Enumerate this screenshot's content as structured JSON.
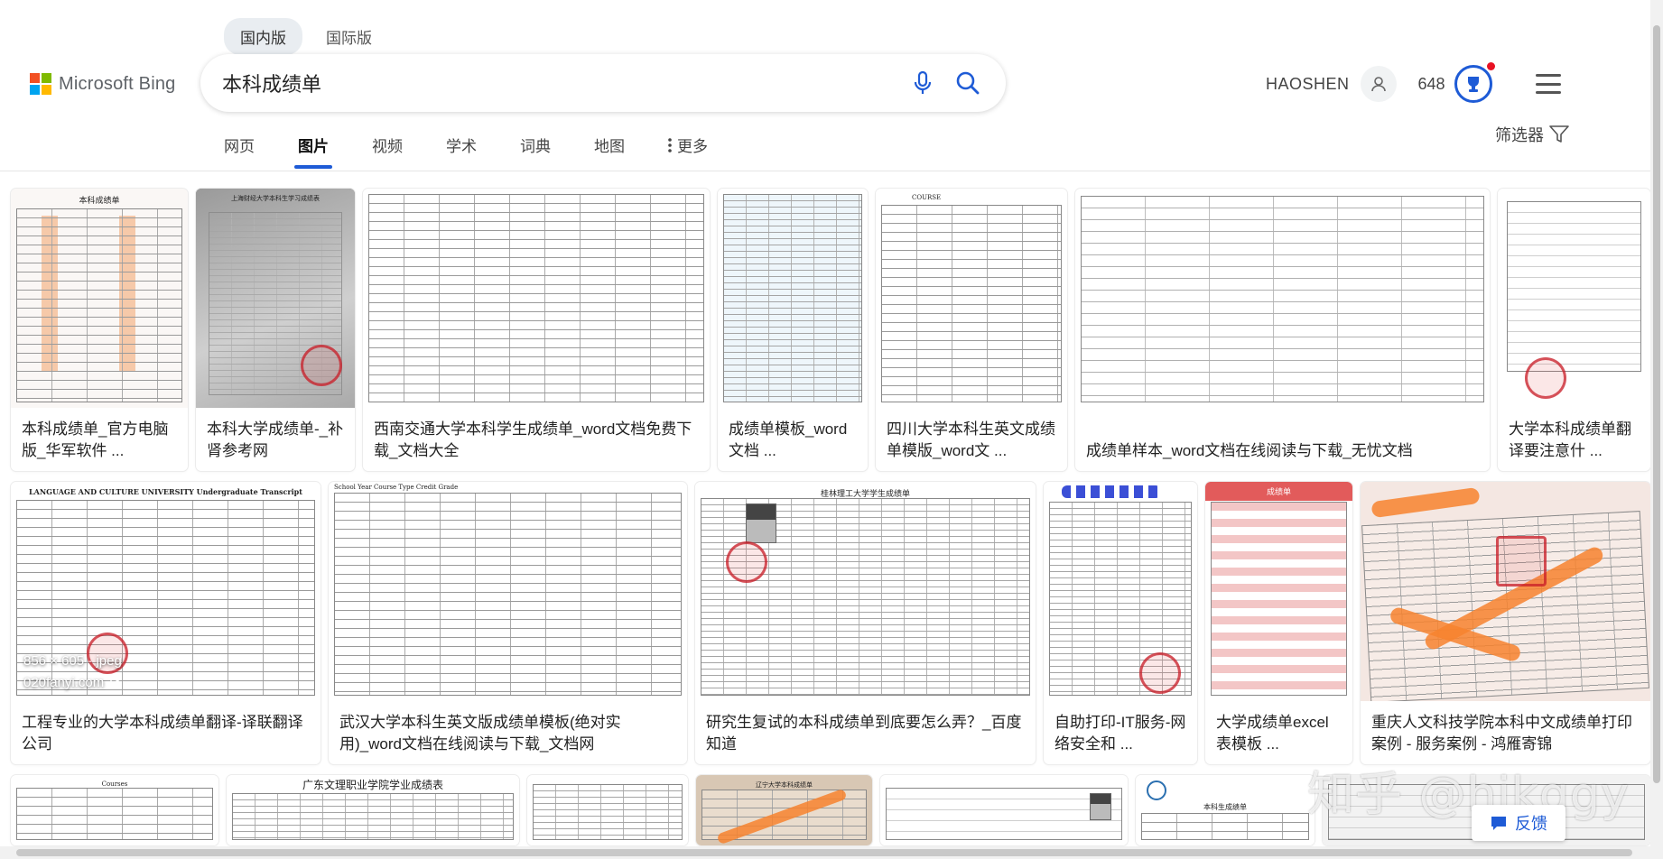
{
  "region_tabs": [
    {
      "label": "国内版",
      "active": true
    },
    {
      "label": "国际版",
      "active": false
    }
  ],
  "brand": {
    "name": "Microsoft Bing",
    "colors": [
      "#f25022",
      "#7fba00",
      "#00a4ef",
      "#ffb900"
    ]
  },
  "search": {
    "query": "本科成绩单",
    "mic_icon": "mic-icon",
    "search_icon": "search-icon"
  },
  "user": {
    "name": "HAOSHEN",
    "points": "648"
  },
  "nav": {
    "items": [
      "网页",
      "图片",
      "视频",
      "学术",
      "词典",
      "地图"
    ],
    "active_index": 1,
    "more_label": "更多",
    "filter_label": "筛选器"
  },
  "accent_color": "#1e5bd6",
  "results": {
    "row1": [
      {
        "caption": "本科成绩单_官方电脑版_华军软件 ...",
        "thumb_title": "本科成绩单"
      },
      {
        "caption": "本科大学成绩单-_补肾参考网",
        "thumb_title": "上海财经大学本科生学习成绩表"
      },
      {
        "caption": "西南交通大学本科学生成绩单_word文档免费下载_文档大全",
        "thumb_title": ""
      },
      {
        "caption": "成绩单模板_word文档 ...",
        "thumb_title": ""
      },
      {
        "caption": "四川大学本科生英文成绩单模版_word文 ...",
        "thumb_title": "COURSE"
      },
      {
        "caption": "成绩单样本_word文档在线阅读与下载_无忧文档",
        "thumb_title": ""
      },
      {
        "caption": "大学本科成绩单翻译要注意什 ...",
        "thumb_title": ""
      }
    ],
    "row2": [
      {
        "caption": "工程专业的大学本科成绩单翻译-译联翻译公司",
        "thumb_title": "LANGUAGE AND CULTURE UNIVERSITY   Undergraduate Transcript",
        "overlay_size": "856 × 605 · jpeg",
        "overlay_host": "020fanyi.com"
      },
      {
        "caption": "武汉大学本科生英文版成绩单模板(绝对实用)_word文档在线阅读与下载_文档网",
        "thumb_title": "School Year   Course   Type   Credit   Grade"
      },
      {
        "caption": "研究生复试的本科成绩单到底要怎么弄？_百度知道",
        "thumb_title": "桂林理工大学学生成绩单"
      },
      {
        "caption": "自助打印-IT服务-网络安全和 ...",
        "thumb_title": ""
      },
      {
        "caption": "大学成绩单excel表模板 ...",
        "thumb_title": "成绩单"
      },
      {
        "caption": "重庆人文科技学院本科中文成绩单打印案例 - 服务案例 - 鸿雁寄锦",
        "thumb_title": ""
      }
    ],
    "row3": [
      {
        "thumb_title": "Courses"
      },
      {
        "thumb_title": "广东文理职业学院学业成绩表"
      },
      {
        "thumb_title": ""
      },
      {
        "thumb_title": "辽宁大学本科成绩单"
      },
      {
        "thumb_title": ""
      },
      {
        "thumb_title": "本科生成绩单"
      },
      {
        "thumb_title": ""
      }
    ]
  },
  "watermark": "知乎 @hjkggy",
  "feedback_label": "反馈"
}
